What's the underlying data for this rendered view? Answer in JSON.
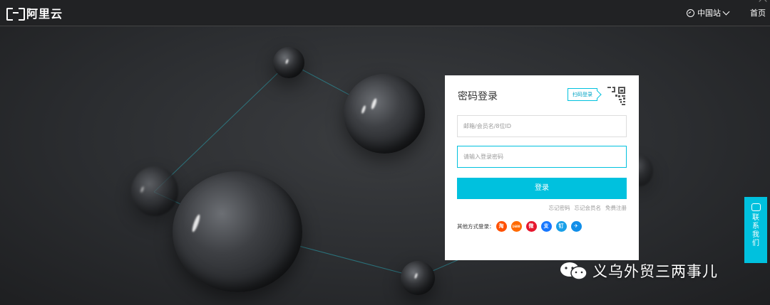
{
  "header": {
    "logo_text": "阿里云",
    "site_switch_label": "中国站",
    "home_label": "首页"
  },
  "login": {
    "title": "密码登录",
    "qr_tag": "扫码登录",
    "username_placeholder": "邮箱/会员名/8位ID",
    "password_placeholder": "请输入登录密码",
    "submit_label": "登录",
    "links": [
      "忘记密码",
      "忘记会员名",
      "免费注册"
    ],
    "other_login_label": "其他方式登录：",
    "social": [
      {
        "name": "taobao",
        "glyph": "淘",
        "color": "#ff5000"
      },
      {
        "name": "1688",
        "glyph": "1688",
        "color": "#ff6a00"
      },
      {
        "name": "weibo",
        "glyph": "微",
        "color": "#e6162d"
      },
      {
        "name": "alipay",
        "glyph": "支",
        "color": "#1677ff"
      },
      {
        "name": "dingtalk",
        "glyph": "钉",
        "color": "#1aa0e8"
      },
      {
        "name": "more",
        "glyph": "✈",
        "color": "#108ee9"
      }
    ]
  },
  "contact": {
    "label": "联系我们"
  },
  "watermark": {
    "text": "义乌外贸三两事儿"
  },
  "colors": {
    "accent": "#00c1de",
    "background": "#2b2d30"
  }
}
